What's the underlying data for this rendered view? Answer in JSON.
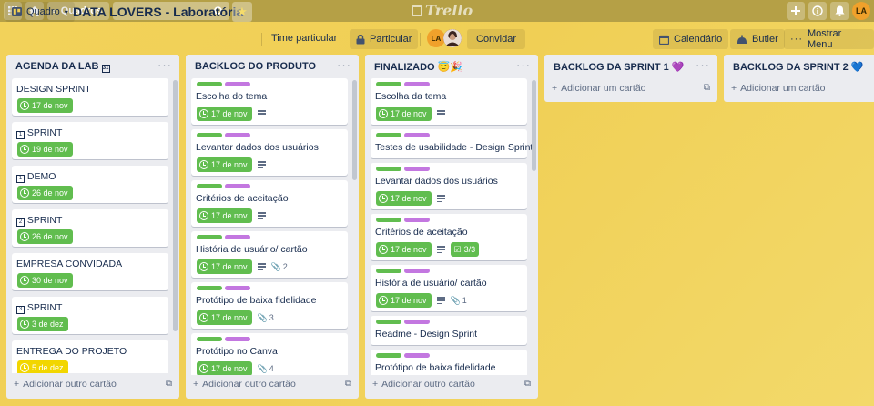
{
  "topbar": {
    "boards_label": "Quadros",
    "logo_text": "Trello",
    "user_initials": "LA",
    "icons": [
      "apps-grid-icon",
      "home-icon",
      "search-icon",
      "plus-icon",
      "info-icon",
      "bell-icon"
    ]
  },
  "board": {
    "view_label": "Quadro",
    "title": "DATA LOVERS - Laboratória",
    "team_label": "Time particular",
    "visibility_label": "Particular",
    "member_initials": "LA",
    "invite_label": "Convidar",
    "calendar_label": "Calendário",
    "butler_label": "Butler",
    "show_menu_label": "Mostrar Menu"
  },
  "colors": {
    "green_label": "#61bd4f",
    "purple_label": "#c377e0",
    "yellow_due": "#f2d600",
    "board_bg": "#f0cf55"
  },
  "lists": [
    {
      "title": "AGENDA DA LAB",
      "title_icon": "31",
      "add_label": "Adicionar outro cartão",
      "cards": [
        {
          "title": "DESIGN SPRINT",
          "date": "17 de nov"
        },
        {
          "title": "SPRINT",
          "title_icon": "1",
          "date": "19 de nov"
        },
        {
          "title": "DEMO",
          "title_icon": "1",
          "date": "26 de nov"
        },
        {
          "title": "SPRINT",
          "title_icon": "2",
          "date": "26 de nov"
        },
        {
          "title": "EMPRESA CONVIDADA",
          "date": "30 de nov"
        },
        {
          "title": "SPRINT",
          "title_icon": "3",
          "date": "3 de dez"
        },
        {
          "title": "ENTREGA DO PROJETO",
          "date": "5 de dez",
          "date_color": "yellow"
        }
      ]
    },
    {
      "title": "BACKLOG DO PRODUTO",
      "add_label": "Adicionar outro cartão",
      "cards": [
        {
          "title": "Escolha do tema",
          "date": "17 de nov",
          "desc": true
        },
        {
          "title": "Levantar dados dos usuários",
          "date": "17 de nov",
          "desc": true
        },
        {
          "title": "Critérios de aceitação",
          "date": "17 de nov",
          "desc": true
        },
        {
          "title": "História de usuário/ cartão",
          "date": "17 de nov",
          "desc": true,
          "attachments": "2"
        },
        {
          "title": "Protótipo de baixa fidelidade",
          "date": "17 de nov",
          "attachments": "3"
        },
        {
          "title": "Protótipo no Canva",
          "date": "17 de nov",
          "attachments": "4"
        }
      ]
    },
    {
      "title": "FINALIZADO",
      "title_emoji": "😇🎉",
      "add_label": "Adicionar outro cartão",
      "cards": [
        {
          "title": "Escolha da tema",
          "date": "17 de nov",
          "desc": true
        },
        {
          "title": "Testes de usabilidade - Design Sprint"
        },
        {
          "title": "Levantar dados dos usuários",
          "date": "17 de nov",
          "desc": true
        },
        {
          "title": "Critérios de aceitação",
          "date": "17 de nov",
          "desc": true,
          "checklist": "3/3"
        },
        {
          "title": "História de usuário/ cartão",
          "date": "17 de nov",
          "desc": true,
          "attachments": "1"
        },
        {
          "title": "Readme - Design Sprint"
        },
        {
          "title": "Protótipo de baixa fidelidade"
        }
      ]
    },
    {
      "title": "BACKLOG DA SPRINT 1",
      "title_emoji": "💜",
      "add_label": "Adicionar um cartão",
      "cards": []
    },
    {
      "title": "BACKLOG DA SPRINT 2",
      "title_emoji": "💙",
      "add_label": "Adicionar um cartão",
      "cards": []
    }
  ]
}
